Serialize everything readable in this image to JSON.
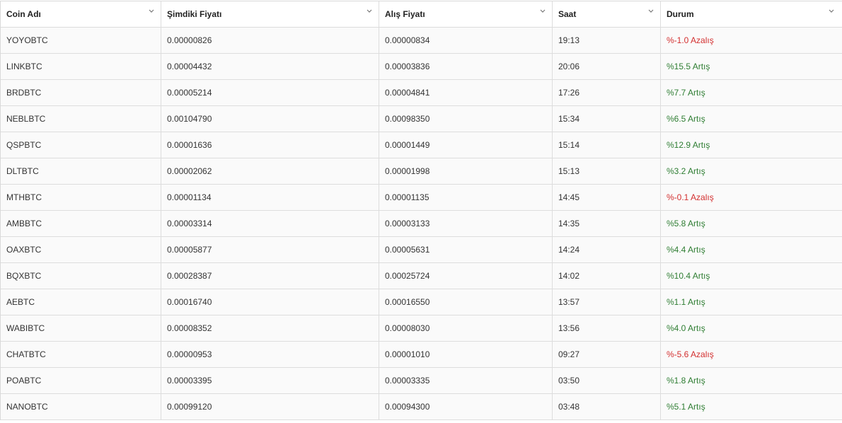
{
  "table": {
    "columns": [
      {
        "label": "Coin Adı",
        "icon": "chevron-down-icon"
      },
      {
        "label": "Şimdiki Fiyatı",
        "icon": "chevron-down-icon"
      },
      {
        "label": "Alış Fiyatı",
        "icon": "chevron-down-icon"
      },
      {
        "label": "Saat",
        "icon": "chevron-down-icon"
      },
      {
        "label": "Durum",
        "icon": "chevron-down-icon"
      }
    ],
    "rows": [
      {
        "coin": "YOYOBTC",
        "current": "0.00000826",
        "buy": "0.00000834",
        "time": "19:13",
        "status": "%-1.0 Azalış",
        "trend": "down"
      },
      {
        "coin": "LINKBTC",
        "current": "0.00004432",
        "buy": "0.00003836",
        "time": "20:06",
        "status": "%15.5 Artış",
        "trend": "up"
      },
      {
        "coin": "BRDBTC",
        "current": "0.00005214",
        "buy": "0.00004841",
        "time": "17:26",
        "status": "%7.7 Artış",
        "trend": "up"
      },
      {
        "coin": "NEBLBTC",
        "current": "0.00104790",
        "buy": "0.00098350",
        "time": "15:34",
        "status": "%6.5 Artış",
        "trend": "up"
      },
      {
        "coin": "QSPBTC",
        "current": "0.00001636",
        "buy": "0.00001449",
        "time": "15:14",
        "status": "%12.9 Artış",
        "trend": "up"
      },
      {
        "coin": "DLTBTC",
        "current": "0.00002062",
        "buy": "0.00001998",
        "time": "15:13",
        "status": "%3.2 Artış",
        "trend": "up"
      },
      {
        "coin": "MTHBTC",
        "current": "0.00001134",
        "buy": "0.00001135",
        "time": "14:45",
        "status": "%-0.1 Azalış",
        "trend": "down"
      },
      {
        "coin": "AMBBTC",
        "current": "0.00003314",
        "buy": "0.00003133",
        "time": "14:35",
        "status": "%5.8 Artış",
        "trend": "up"
      },
      {
        "coin": "OAXBTC",
        "current": "0.00005877",
        "buy": "0.00005631",
        "time": "14:24",
        "status": "%4.4 Artış",
        "trend": "up"
      },
      {
        "coin": "BQXBTC",
        "current": "0.00028387",
        "buy": "0.00025724",
        "time": "14:02",
        "status": "%10.4 Artış",
        "trend": "up"
      },
      {
        "coin": "AEBTC",
        "current": "0.00016740",
        "buy": "0.00016550",
        "time": "13:57",
        "status": "%1.1 Artış",
        "trend": "up"
      },
      {
        "coin": "WABIBTC",
        "current": "0.00008352",
        "buy": "0.00008030",
        "time": "13:56",
        "status": "%4.0 Artış",
        "trend": "up"
      },
      {
        "coin": "CHATBTC",
        "current": "0.00000953",
        "buy": "0.00001010",
        "time": "09:27",
        "status": "%-5.6 Azalış",
        "trend": "down"
      },
      {
        "coin": "POABTC",
        "current": "0.00003395",
        "buy": "0.00003335",
        "time": "03:50",
        "status": "%1.8 Artış",
        "trend": "up"
      },
      {
        "coin": "NANOBTC",
        "current": "0.00099120",
        "buy": "0.00094300",
        "time": "03:48",
        "status": "%5.1 Artış",
        "trend": "up"
      }
    ]
  },
  "colors": {
    "up": "#2e7d32",
    "down": "#d32f2f"
  }
}
